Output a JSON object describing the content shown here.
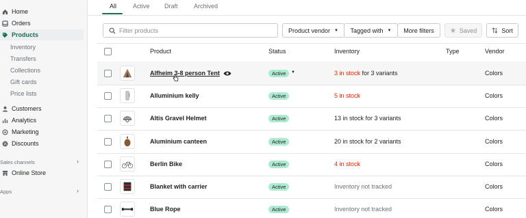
{
  "sidebar": {
    "home": "Home",
    "orders": "Orders",
    "products": "Products",
    "sub": [
      "Inventory",
      "Transfers",
      "Collections",
      "Gift cards",
      "Price lists"
    ],
    "customers": "Customers",
    "analytics": "Analytics",
    "marketing": "Marketing",
    "discounts": "Discounts",
    "sales_channels": "Sales channels",
    "online_store": "Online Store",
    "apps": "Apps"
  },
  "tabs": [
    "All",
    "Active",
    "Draft",
    "Archived"
  ],
  "filters": {
    "search_placeholder": "Filter products",
    "product_vendor": "Product vendor",
    "tagged_with": "Tagged with",
    "more_filters": "More filters",
    "saved": "Saved",
    "sort": "Sort"
  },
  "table": {
    "headers": {
      "product": "Product",
      "status": "Status",
      "inventory": "Inventory",
      "type": "Type",
      "vendor": "Vendor"
    },
    "rows": [
      {
        "name": "Alfheim 3-8 person Tent",
        "status": "Active",
        "inv_red": "3 in stock",
        "inv_rest": " for 3 variants",
        "vendor": "Colors",
        "thumb": "tent"
      },
      {
        "name": "Alluminium kelly",
        "status": "Active",
        "inv_red": "5 in stock",
        "inv_rest": "",
        "vendor": "Colors",
        "thumb": "kelly"
      },
      {
        "name": "Altis Gravel Helmet",
        "status": "Active",
        "inv_plain": "13 in stock for 3 variants",
        "vendor": "Colors",
        "thumb": "helmet"
      },
      {
        "name": "Aluminium canteen",
        "status": "Active",
        "inv_plain": "20 in stock for 2 variants",
        "vendor": "Colors",
        "thumb": "canteen"
      },
      {
        "name": "Berlin Bike",
        "status": "Active",
        "inv_red": "4 in stock",
        "inv_rest": "",
        "vendor": "Colors",
        "thumb": "bike"
      },
      {
        "name": "Blanket with carrier",
        "status": "Active",
        "inv_gray": "Inventory not tracked",
        "vendor": "Colors",
        "thumb": "blanket"
      },
      {
        "name": "Blue Rope",
        "status": "Active",
        "inv_gray": "Inventory not tracked",
        "vendor": "Colors",
        "thumb": "rope"
      }
    ]
  },
  "colors": {
    "accent": "#1a6e4f",
    "badge": "#aee9d1",
    "critical": "#d72c0d"
  }
}
